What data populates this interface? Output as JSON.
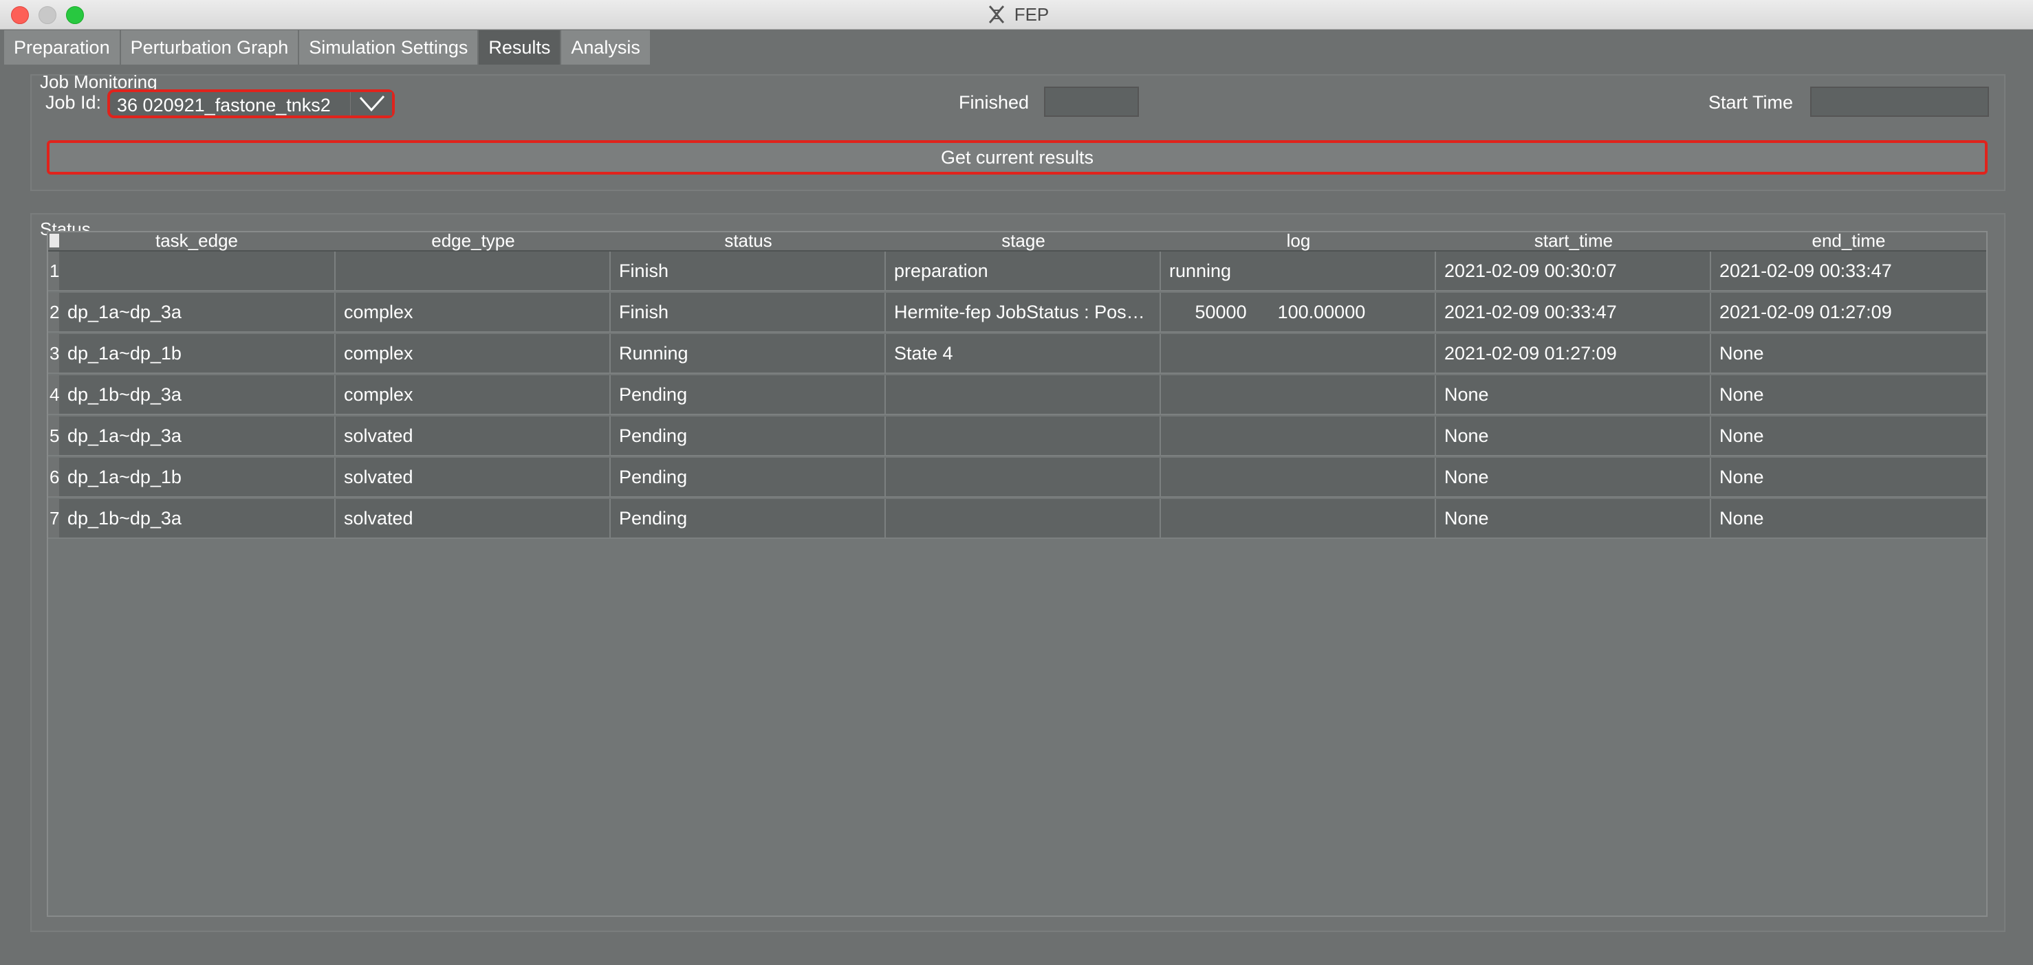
{
  "window": {
    "title": "FEP"
  },
  "tabs": [
    {
      "label": "Preparation"
    },
    {
      "label": "Perturbation Graph"
    },
    {
      "label": "Simulation Settings"
    },
    {
      "label": "Results"
    },
    {
      "label": "Analysis"
    }
  ],
  "active_tab": "Results",
  "job_monitoring": {
    "title": "Job Monitoring",
    "job_id_label": "Job Id:",
    "job_id_value": "36 020921_fastone_tnks2",
    "finished_label": "Finished",
    "finished_value": "",
    "start_time_label": "Start Time",
    "start_time_value": "",
    "get_results_label": "Get current results"
  },
  "status": {
    "title": "Status",
    "columns": [
      "task_edge",
      "edge_type",
      "status",
      "stage",
      "log",
      "start_time",
      "end_time"
    ],
    "rows": [
      {
        "n": "1",
        "task_edge": "",
        "edge_type": "",
        "status": "Finish",
        "stage": "preparation",
        "log": "running",
        "start_time": "2021-02-09 00:30:07",
        "end_time": "2021-02-09 00:33:47"
      },
      {
        "n": "2",
        "task_edge": "dp_1a~dp_3a",
        "edge_type": "complex",
        "status": "Finish",
        "stage": "Hermite-fep JobStatus : Pos…",
        "log": "     50000      100.00000",
        "start_time": "2021-02-09 00:33:47",
        "end_time": "2021-02-09 01:27:09"
      },
      {
        "n": "3",
        "task_edge": "dp_1a~dp_1b",
        "edge_type": "complex",
        "status": "Running",
        "stage": "State 4",
        "log": "",
        "start_time": "2021-02-09 01:27:09",
        "end_time": "None"
      },
      {
        "n": "4",
        "task_edge": "dp_1b~dp_3a",
        "edge_type": "complex",
        "status": "Pending",
        "stage": "",
        "log": "",
        "start_time": "None",
        "end_time": "None"
      },
      {
        "n": "5",
        "task_edge": "dp_1a~dp_3a",
        "edge_type": "solvated",
        "status": "Pending",
        "stage": "",
        "log": "",
        "start_time": "None",
        "end_time": "None"
      },
      {
        "n": "6",
        "task_edge": "dp_1a~dp_1b",
        "edge_type": "solvated",
        "status": "Pending",
        "stage": "",
        "log": "",
        "start_time": "None",
        "end_time": "None"
      },
      {
        "n": "7",
        "task_edge": "dp_1b~dp_3a",
        "edge_type": "solvated",
        "status": "Pending",
        "stage": "",
        "log": "",
        "start_time": "None",
        "end_time": "None"
      }
    ]
  }
}
